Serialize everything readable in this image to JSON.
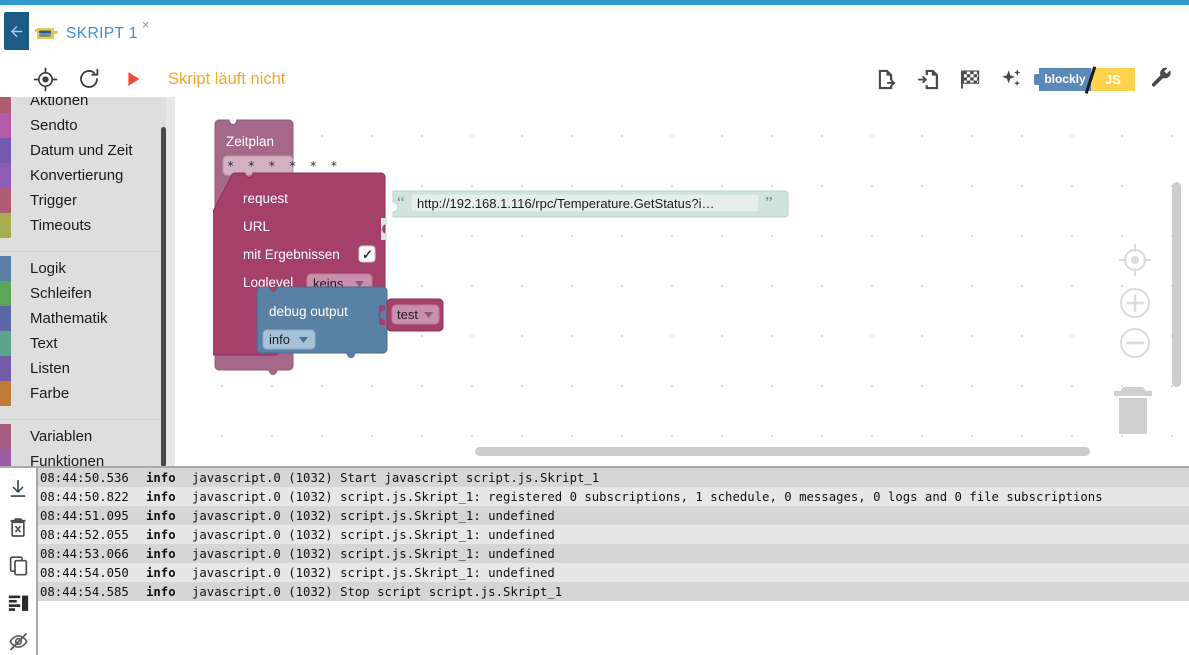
{
  "window": {
    "accent_color": "#3399cc",
    "back_icon": "arrow-left-icon"
  },
  "tab": {
    "label": "SKRIPT 1",
    "icon": "blockly-block-icon",
    "close_label": "×"
  },
  "toolbar": {
    "left_icons": [
      {
        "name": "target-locate-icon",
        "label": "Debug"
      },
      {
        "name": "reload-icon",
        "label": "Neu laden"
      },
      {
        "name": "play-icon",
        "label": "Start"
      }
    ],
    "status_text": "Skript läuft nicht",
    "status_color": "#f5a623",
    "right_icons": [
      {
        "name": "export-blocks-icon",
        "label": "Exportieren"
      },
      {
        "name": "import-blocks-icon",
        "label": "Importieren"
      },
      {
        "name": "checkered-flag-icon",
        "label": "Start/Stop"
      },
      {
        "name": "sparkles-icon",
        "label": "Aufräumen"
      },
      {
        "name": "wrench-icon",
        "label": "Einstellungen"
      }
    ],
    "lang_toggle": {
      "blockly_label": "blockly",
      "js_label": "JS",
      "blockly_color": "#5b89b8",
      "js_color": "#ffd24d"
    }
  },
  "toolbox": {
    "groups": [
      {
        "items": [
          {
            "label": "Aktionen",
            "color": "#b05b6f"
          },
          {
            "label": "Sendto",
            "color": "#b35ba8"
          },
          {
            "label": "Datum und Zeit",
            "color": "#7359b0"
          },
          {
            "label": "Konvertierung",
            "color": "#8c5bb8"
          },
          {
            "label": "Trigger",
            "color": "#b05b74"
          },
          {
            "label": "Timeouts",
            "color": "#a8ac4f"
          }
        ]
      },
      {
        "items": [
          {
            "label": "Logik",
            "color": "#5b80a5"
          },
          {
            "label": "Schleifen",
            "color": "#5ba55b"
          },
          {
            "label": "Mathematik",
            "color": "#5b67a5"
          },
          {
            "label": "Text",
            "color": "#5ba58c"
          },
          {
            "label": "Listen",
            "color": "#745ba5"
          },
          {
            "label": "Farbe",
            "color": "#bf7a39"
          }
        ]
      },
      {
        "items": [
          {
            "label": "Variablen",
            "color": "#a55b80"
          },
          {
            "label": "Funktionen",
            "color": "#9a5ba5"
          }
        ]
      }
    ]
  },
  "workspace": {
    "blocks": {
      "schedule": {
        "title": "Zeitplan",
        "cron_value": "* * * * * *",
        "color": "#a5678a"
      },
      "request": {
        "title": "request",
        "url_label": "URL",
        "with_results_label": "mit Ergebnissen",
        "with_results_checked": "✓",
        "loglevel_label": "Loglevel",
        "loglevel_value": "keins",
        "color": "#a5406a"
      },
      "text_url": {
        "value": "http://192.168.1.116/rpc/Temperature.GetStatus?i…",
        "quote_open": "“",
        "quote_close": "”",
        "color": "#cfe4dc"
      },
      "debug_output": {
        "title": "debug output",
        "level_value": "info",
        "color": "#5b80a5"
      },
      "variable_test": {
        "value": "test",
        "color": "#a5406a"
      }
    },
    "controls": [
      {
        "name": "recenter-icon",
        "label": "Zentrieren"
      },
      {
        "name": "zoom-in-icon",
        "label": "Vergrößern"
      },
      {
        "name": "zoom-out-icon",
        "label": "Verkleinern"
      },
      {
        "name": "trash-icon",
        "label": "Papierkorb"
      }
    ]
  },
  "log": {
    "tools": [
      {
        "name": "scroll-to-bottom-icon",
        "label": "Zum Ende scrollen"
      },
      {
        "name": "clear-log-icon",
        "label": "Log leeren"
      },
      {
        "name": "copy-log-icon",
        "label": "Log kopieren"
      },
      {
        "name": "log-layout-icon",
        "label": "Layout"
      },
      {
        "name": "hide-log-icon",
        "label": "Log ausblenden"
      }
    ],
    "entries": [
      {
        "ts": "08:44:50.536",
        "level": "info",
        "msg": "javascript.0 (1032) Start javascript script.js.Skript_1"
      },
      {
        "ts": "08:44:50.822",
        "level": "info",
        "msg": "javascript.0 (1032) script.js.Skript_1: registered 0 subscriptions, 1 schedule, 0 messages, 0 logs and 0 file subscriptions"
      },
      {
        "ts": "08:44:51.095",
        "level": "info",
        "msg": "javascript.0 (1032) script.js.Skript_1: undefined"
      },
      {
        "ts": "08:44:52.055",
        "level": "info",
        "msg": "javascript.0 (1032) script.js.Skript_1: undefined"
      },
      {
        "ts": "08:44:53.066",
        "level": "info",
        "msg": "javascript.0 (1032) script.js.Skript_1: undefined"
      },
      {
        "ts": "08:44:54.050",
        "level": "info",
        "msg": "javascript.0 (1032) script.js.Skript_1: undefined"
      },
      {
        "ts": "08:44:54.585",
        "level": "info",
        "msg": "javascript.0 (1032) Stop script script.js.Skript_1"
      }
    ]
  }
}
